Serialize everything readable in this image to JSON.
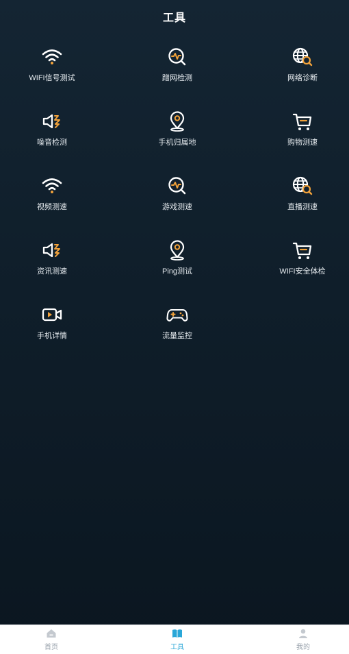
{
  "header": {
    "title": "工具"
  },
  "tools": [
    {
      "label": "WIFI信号测试",
      "icon": "wifi-icon"
    },
    {
      "label": "蹭网检测",
      "icon": "pulse-search-icon"
    },
    {
      "label": "网络诊断",
      "icon": "globe-search-icon"
    },
    {
      "label": "噪音检测",
      "icon": "speaker-icon"
    },
    {
      "label": "手机归属地",
      "icon": "location-pin-icon"
    },
    {
      "label": "购物测速",
      "icon": "shopping-cart-icon"
    },
    {
      "label": "视频测速",
      "icon": "wifi-icon"
    },
    {
      "label": "游戏测速",
      "icon": "pulse-search-icon"
    },
    {
      "label": "直播测速",
      "icon": "globe-search-icon"
    },
    {
      "label": "资讯测速",
      "icon": "speaker-icon"
    },
    {
      "label": "Ping测试",
      "icon": "location-pin-icon"
    },
    {
      "label": "WIFI安全体检",
      "icon": "shopping-cart-icon"
    },
    {
      "label": "手机详情",
      "icon": "video-camera-icon"
    },
    {
      "label": "流量监控",
      "icon": "gamepad-icon"
    }
  ],
  "tabbar": {
    "items": [
      {
        "label": "首页",
        "icon": "home-icon",
        "active": false
      },
      {
        "label": "工具",
        "icon": "book-icon",
        "active": true
      },
      {
        "label": "我的",
        "icon": "user-icon",
        "active": false
      }
    ]
  },
  "colors": {
    "accent_orange": "#f2a23a",
    "active_tab": "#2aa7d8",
    "icon_white": "#ffffff"
  }
}
